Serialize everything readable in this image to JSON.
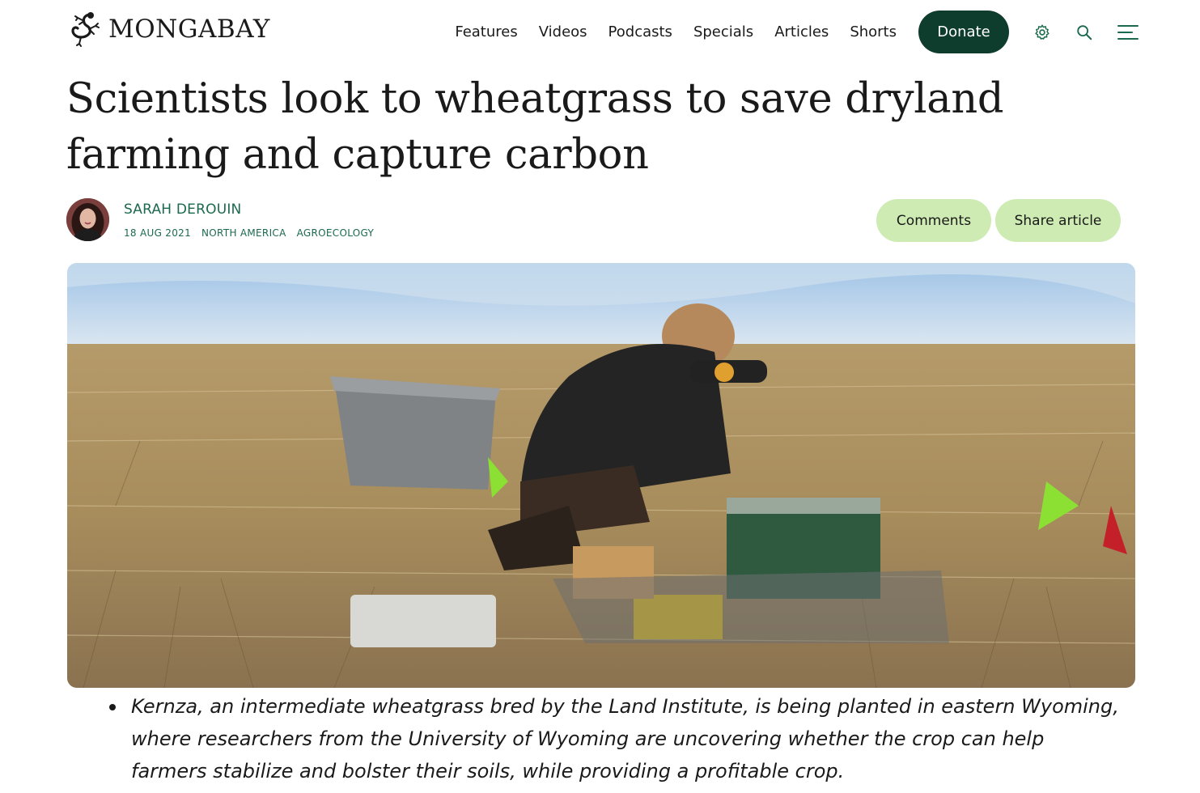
{
  "header": {
    "logo_text": "MONGABAY",
    "logo_icon": "gecko-icon",
    "nav": [
      "Features",
      "Videos",
      "Podcasts",
      "Specials",
      "Articles",
      "Shorts"
    ],
    "donate_label": "Donate",
    "icons": [
      "gear-icon",
      "search-icon",
      "menu-icon"
    ]
  },
  "article": {
    "title": "Scientists look to wheatgrass to save dryland farming and capture carbon",
    "author": "SARAH DEROUIN",
    "date": "18 AUG 2021",
    "tags": [
      "NORTH AMERICA",
      "AGROECOLOGY"
    ],
    "comments_label": "Comments",
    "share_label": "Share article",
    "bullets": [
      "Kernza, an intermediate wheatgrass bred by the Land Institute, is being planted in eastern Wyoming, where researchers from the University of Wyoming are uncovering whether the crop can help farmers stabilize and bolster their soils, while providing a profitable crop."
    ]
  },
  "colors": {
    "brand_dark_green": "#0e3c2d",
    "accent_green_text": "#1b6a4e",
    "pill_bg": "#cdebb2"
  }
}
